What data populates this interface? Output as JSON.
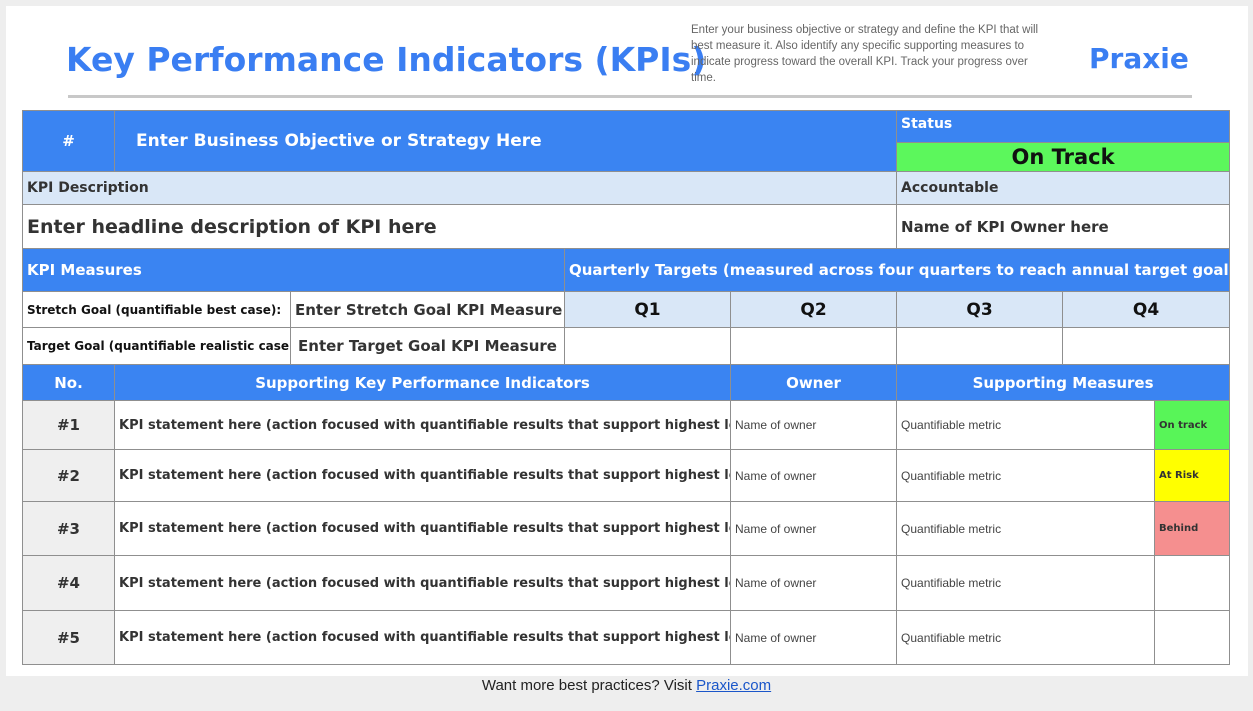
{
  "header": {
    "title": "Key Performance Indicators (KPIs)",
    "instructions": "Enter your business objective or strategy and define the KPI that will best measure it. Also identify any specific supporting measures to indicate progress toward the overall KPI. Track your progress over time.",
    "logo": "Praxie"
  },
  "objective": {
    "number_label": "#",
    "objective_text": "Enter Business Objective or Strategy Here",
    "status_label": "Status",
    "status_value": "On Track"
  },
  "kpi_description": {
    "label": "KPI Description",
    "value": "Enter headline description of KPI here",
    "accountable_label": "Accountable",
    "accountable_value": "Name of KPI Owner here"
  },
  "measures": {
    "label": "KPI Measures",
    "quarterly_label": "Quarterly Targets (measured across four quarters to reach annual target goal)",
    "quarters": [
      "Q1",
      "Q2",
      "Q3",
      "Q4"
    ],
    "stretch_label": "Stretch Goal (quantifiable best case):",
    "stretch_value": "Enter Stretch Goal KPI Measure",
    "target_label": "Target Goal (quantifiable realistic case):",
    "target_value": "Enter Target Goal KPI Measure"
  },
  "supporting": {
    "headers": {
      "no": "No.",
      "kpis": "Supporting Key Performance Indicators",
      "owner": "Owner",
      "measures": "Supporting Measures"
    },
    "rows": [
      {
        "no": "#1",
        "kpi": "KPI statement here (action focused with quantifiable results that support highest level KPI)",
        "owner": "Name of owner",
        "metric": "Quantifiable metric",
        "status": "On track",
        "status_color": "#58f558"
      },
      {
        "no": "#2",
        "kpi": "KPI statement here (action focused with quantifiable results that support highest level KPI)",
        "owner": "Name of owner",
        "metric": "Quantifiable metric",
        "status": "At Risk",
        "status_color": "#ffff00"
      },
      {
        "no": "#3",
        "kpi": "KPI statement here (action focused with quantifiable results that support highest level KPI)",
        "owner": "Name of owner",
        "metric": "Quantifiable metric",
        "status": "Behind",
        "status_color": "#f58f8f"
      },
      {
        "no": "#4",
        "kpi": "KPI statement here (action focused with quantifiable results that support highest level KPI)",
        "owner": "Name of owner",
        "metric": "Quantifiable metric",
        "status": "",
        "status_color": "#ffffff"
      },
      {
        "no": "#5",
        "kpi": "KPI statement here (action focused with quantifiable results that support highest level KPI)",
        "owner": "Name of owner",
        "metric": "Quantifiable metric",
        "status": "",
        "status_color": "#ffffff"
      }
    ]
  },
  "colors": {
    "header_blue": "#3a84f2",
    "light_blue": "#d9e7f7",
    "on_track_green": "#5cf75c"
  },
  "footer": {
    "text": "Want more best practices? Visit",
    "link": "Praxie.com"
  }
}
